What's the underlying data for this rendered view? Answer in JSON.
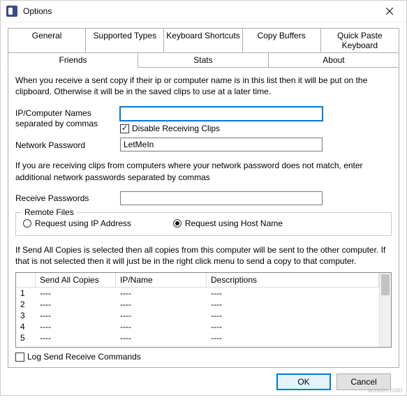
{
  "window": {
    "title": "Options"
  },
  "tabs": {
    "row1": [
      "General",
      "Supported Types",
      "Keyboard Shortcuts",
      "Copy Buffers",
      "Quick Paste Keyboard"
    ],
    "row2": [
      "Friends",
      "Stats",
      "About"
    ],
    "active": "Friends"
  },
  "intro": "When you receive a sent copy if their ip or computer name is in this list then it will be put on the clipboard.  Otherwise it will be in the saved clips to use at a later time.",
  "labels": {
    "ipnames": "IP/Computer Names separated by commas",
    "disable_recv": "Disable Receiving Clips",
    "netpass": "Network Password",
    "recvpass": "Receive Passwords",
    "remote_files": "Remote Files",
    "req_ip": "Request using IP Address",
    "req_host": "Request using Host Name",
    "log_cmds": "Log Send Receive Commands"
  },
  "values": {
    "ipnames": "",
    "netpass": "LetMeIn",
    "recvpass": "",
    "disable_recv_checked": true,
    "remote_mode": "host",
    "log_checked": false
  },
  "note": "If you are receiving clips from computers where your network password does not match, enter additional network passwords separated by commas",
  "para2": "If Send All Copies is selected then all copies from this computer will be sent to the other computer.  If that is not selected then it will just be in the right click menu to send a copy to that computer.",
  "grid": {
    "headers": {
      "rn": "",
      "sac": "Send All Copies",
      "ipn": "IP/Name",
      "desc": "Descriptions"
    },
    "rows": [
      {
        "n": "1",
        "sac": "----",
        "ipn": "----",
        "desc": "----"
      },
      {
        "n": "2",
        "sac": "----",
        "ipn": "----",
        "desc": "----"
      },
      {
        "n": "3",
        "sac": "----",
        "ipn": "----",
        "desc": "----"
      },
      {
        "n": "4",
        "sac": "----",
        "ipn": "----",
        "desc": "----"
      },
      {
        "n": "5",
        "sac": "----",
        "ipn": "----",
        "desc": "----"
      }
    ]
  },
  "buttons": {
    "ok": "OK",
    "cancel": "Cancel"
  },
  "watermark": "wsxdn.com"
}
